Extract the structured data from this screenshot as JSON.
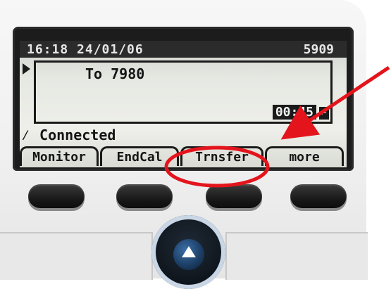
{
  "display": {
    "datetime": "16:18 24/01/06",
    "extension": "5909",
    "call_to": "To 7980",
    "duration": "00:45",
    "status": "Connected"
  },
  "softkeys": [
    {
      "label": "Monitor"
    },
    {
      "label": "EndCal"
    },
    {
      "label": "Trnsfer"
    },
    {
      "label": "more"
    }
  ],
  "hardware": {
    "navigation_up": "up-arrow"
  },
  "colors": {
    "annotation": "#e4141c",
    "lcd_background": "#e6e8e2",
    "lcd_text": "#151515",
    "header_background": "#2b2b2b",
    "hardware_key": "#161616",
    "nav_ring": "#c9d6e6"
  },
  "annotation": {
    "highlighted_softkey": "Trnsfer"
  }
}
